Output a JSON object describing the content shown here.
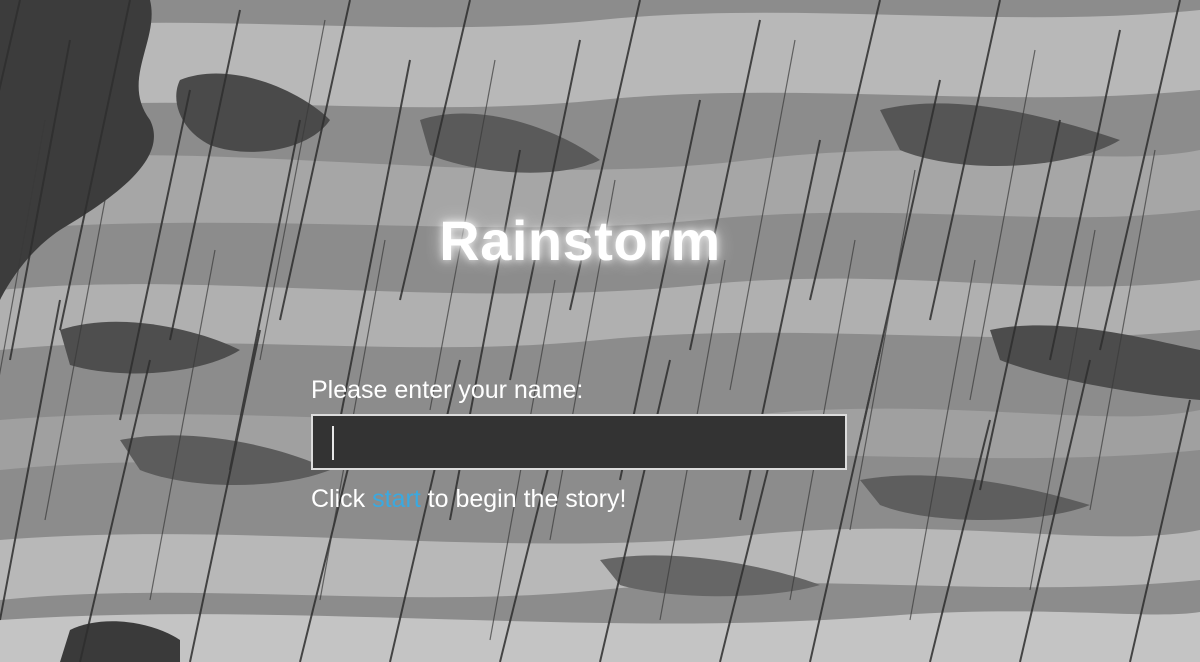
{
  "game": {
    "title": "Rainstorm",
    "name_prompt": "Please enter your name:",
    "name_input": {
      "value": "",
      "placeholder": ""
    },
    "hint_before": "Click ",
    "start_link": "start",
    "hint_after": " to begin the story!",
    "link_color": "#3aa9e0"
  },
  "background": {
    "image": "rainstorm-clouds",
    "palette": [
      "#3a3a3a",
      "#5e5e5e",
      "#8a8a8a",
      "#b4b4b4",
      "#d6d6d6"
    ]
  }
}
